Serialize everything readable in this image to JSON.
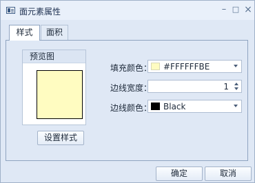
{
  "window": {
    "title": "面元素属性",
    "icon": "app-icon",
    "controls": {
      "minimize": "–",
      "maximize": "□",
      "close": "×"
    }
  },
  "tabs": [
    {
      "label": "样式",
      "active": true
    },
    {
      "label": "面积",
      "active": false
    }
  ],
  "preview": {
    "header": "预览图",
    "fill_color": "#FFFCC1",
    "border_color": "#000000",
    "button_label": "设置样式"
  },
  "fields": {
    "fill_label": "填充颜色：",
    "fill_value": "#FFFFFFBE",
    "fill_chip_color": "#FFFCC1",
    "line_width_label": "边线宽度：",
    "line_width_value": "1",
    "line_color_label": "边线颜色：",
    "line_color_value": "Black",
    "line_color_chip": "#000000"
  },
  "footer": {
    "ok_label": "确定",
    "cancel_label": "取消"
  }
}
